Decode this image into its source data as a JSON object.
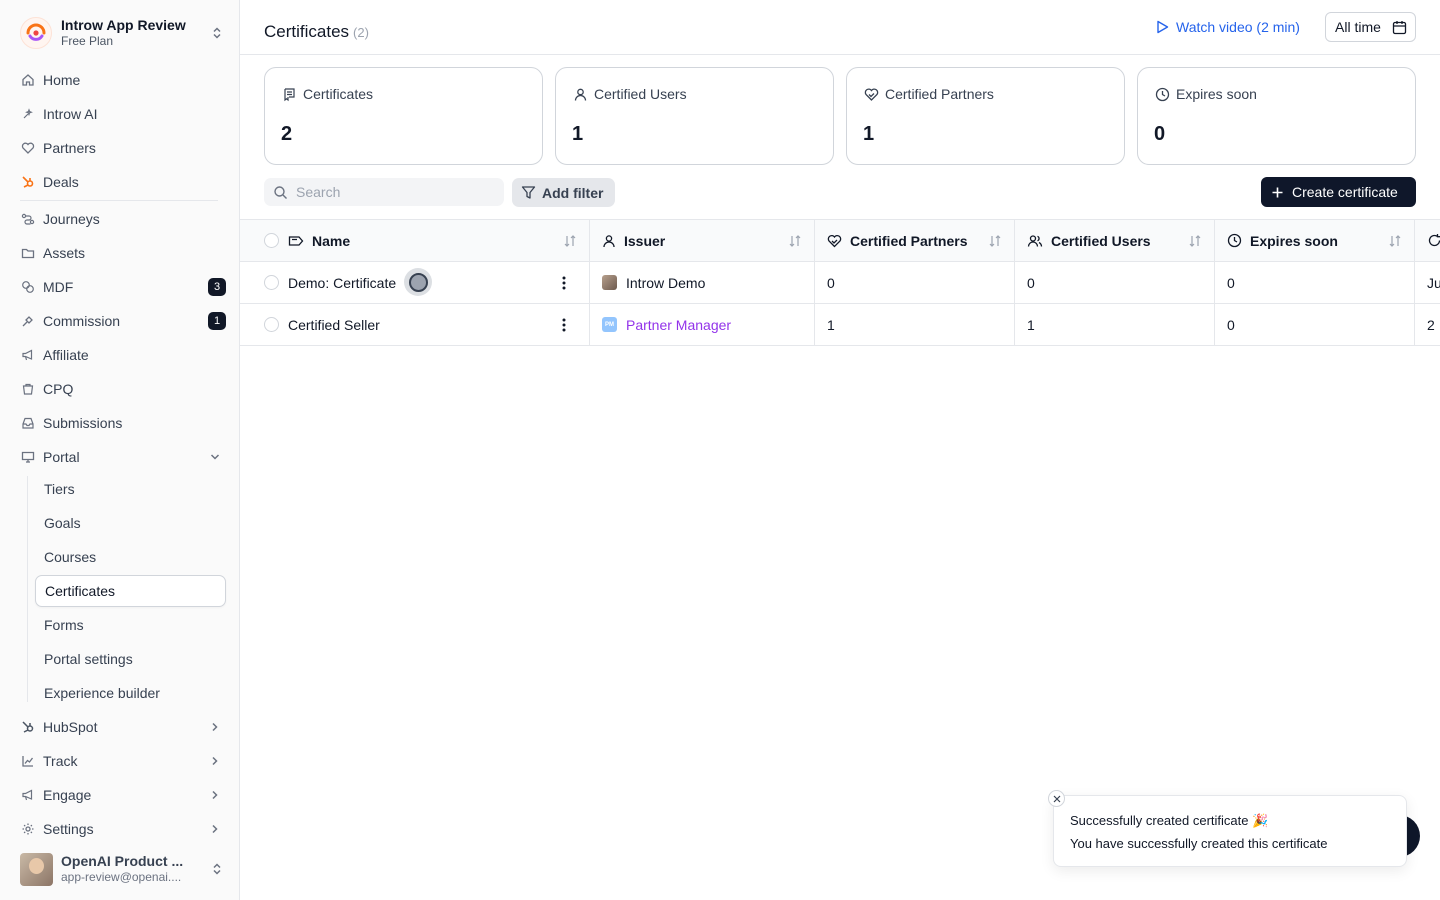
{
  "workspace": {
    "name": "Introw App Review",
    "plan": "Free Plan"
  },
  "sidebar": {
    "items": [
      {
        "label": "Home",
        "icon": "home-icon"
      },
      {
        "label": "Introw AI",
        "icon": "sparkle-icon"
      },
      {
        "label": "Partners",
        "icon": "handshake-heart-icon"
      },
      {
        "label": "Deals",
        "icon": "hubspot-icon"
      },
      {
        "label": "Journeys",
        "icon": "route-icon"
      },
      {
        "label": "Assets",
        "icon": "folder-icon"
      },
      {
        "label": "MDF",
        "icon": "percent-coins-icon",
        "badge": "3"
      },
      {
        "label": "Commission",
        "icon": "coins-icon",
        "badge": "1"
      },
      {
        "label": "Affiliate",
        "icon": "megaphone-icon"
      },
      {
        "label": "CPQ",
        "icon": "calculator-icon"
      },
      {
        "label": "Submissions",
        "icon": "inbox-icon"
      },
      {
        "label": "Portal",
        "icon": "monitor-icon"
      }
    ],
    "portal_sub": [
      "Tiers",
      "Goals",
      "Courses",
      "Certificates",
      "Forms",
      "Portal settings",
      "Experience builder"
    ],
    "bottom_items": [
      {
        "label": "HubSpot",
        "icon": "hubspot-icon"
      },
      {
        "label": "Track",
        "icon": "chart-line-icon"
      },
      {
        "label": "Engage",
        "icon": "megaphone-icon"
      },
      {
        "label": "Settings",
        "icon": "gear-icon"
      }
    ],
    "active_sub": "Certificates"
  },
  "user": {
    "name": "OpenAI Product ...",
    "email": "app-review@openai...."
  },
  "header": {
    "title": "Certificates",
    "count": "(2)",
    "watch_video": "Watch video (2 min)",
    "date_range": "All time"
  },
  "stats": [
    {
      "label": "Certificates",
      "value": "2",
      "icon": "certificate-icon"
    },
    {
      "label": "Certified Users",
      "value": "1",
      "icon": "user-icon"
    },
    {
      "label": "Certified Partners",
      "value": "1",
      "icon": "handshake-heart-icon"
    },
    {
      "label": "Expires soon",
      "value": "0",
      "icon": "clock-icon"
    }
  ],
  "toolbar": {
    "search_placeholder": "Search",
    "add_filter": "Add filter",
    "create": "Create certificate"
  },
  "table": {
    "columns": [
      "Name",
      "Issuer",
      "Certified Partners",
      "Certified Users",
      "Expires soon"
    ],
    "rows": [
      {
        "name": "Demo: Certificate",
        "issuer": "Introw Demo",
        "certified_partners": "0",
        "certified_users": "0",
        "expires_soon": "0",
        "more": "Ju"
      },
      {
        "name": "Certified Seller",
        "issuer": "Partner Manager",
        "certified_partners": "1",
        "certified_users": "1",
        "expires_soon": "0",
        "more": "2"
      }
    ],
    "issuer_initials": "PM"
  },
  "toast": {
    "title": "Successfully created certificate 🎉",
    "message": "You have successfully created this certificate"
  },
  "colors": {
    "accent_link": "#2563eb",
    "primary_dark": "#0f172a",
    "purple_link": "#9333ea"
  }
}
